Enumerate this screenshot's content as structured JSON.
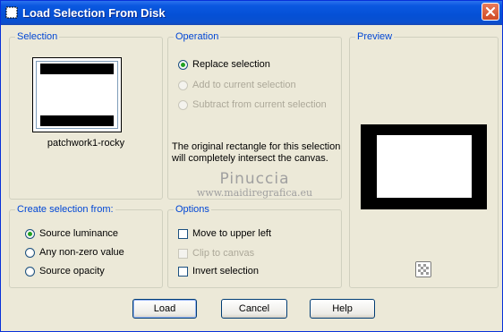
{
  "window": {
    "title": "Load Selection From Disk",
    "icon": "selection-load-icon",
    "close_icon": "close-icon"
  },
  "selection": {
    "legend": "Selection",
    "filename": "patchwork1-rocky"
  },
  "operation": {
    "legend": "Operation",
    "options": [
      {
        "label": "Replace selection",
        "checked": true,
        "enabled": true
      },
      {
        "label": "Add to current selection",
        "checked": false,
        "enabled": false
      },
      {
        "label": "Subtract from current selection",
        "checked": false,
        "enabled": false
      }
    ],
    "note": "The original rectangle for this selection will completely intersect the canvas."
  },
  "watermark": {
    "name": "Pinuccia",
    "url": "www.maidiregrafica.eu"
  },
  "preview": {
    "legend": "Preview",
    "zoom_icon": "checkerboard-zoom-icon"
  },
  "create_from": {
    "legend": "Create selection from:",
    "options": [
      {
        "label": "Source luminance",
        "checked": true
      },
      {
        "label": "Any non-zero value",
        "checked": false
      },
      {
        "label": "Source opacity",
        "checked": false
      }
    ]
  },
  "options": {
    "legend": "Options",
    "items": [
      {
        "label": "Move to upper left",
        "checked": false,
        "enabled": true
      },
      {
        "label": "Clip to canvas",
        "checked": false,
        "enabled": false
      },
      {
        "label": "Invert selection",
        "checked": false,
        "enabled": true
      }
    ]
  },
  "buttons": {
    "load": "Load",
    "cancel": "Cancel",
    "help": "Help"
  },
  "colors": {
    "titlebar": "#0550d5",
    "dialog_bg": "#ece9d8",
    "legend_text": "#0046d5",
    "radio_dot": "#21a121",
    "disabled_text": "#aca899"
  }
}
